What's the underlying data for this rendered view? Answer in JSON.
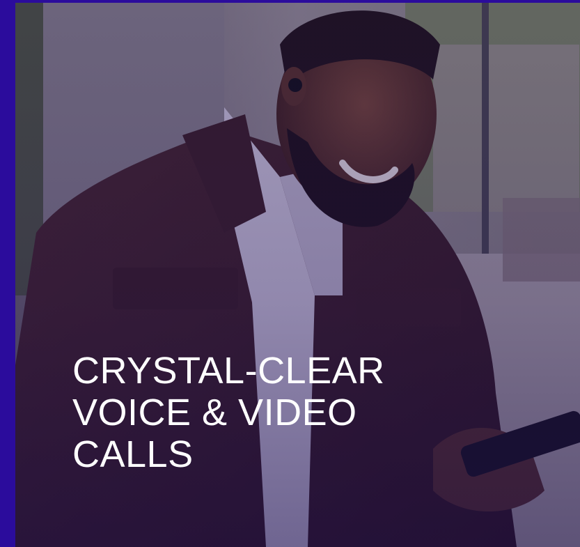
{
  "hero": {
    "headline_lines": [
      "CRYSTAL-CLEAR",
      "VOICE & VIDEO",
      "CALLS"
    ]
  },
  "image": {
    "subject": "photo-man-smiling-at-phone"
  },
  "colors": {
    "frame": "#2b0c9c",
    "text": "#ffffff",
    "overlay": "#1e0c5a"
  }
}
